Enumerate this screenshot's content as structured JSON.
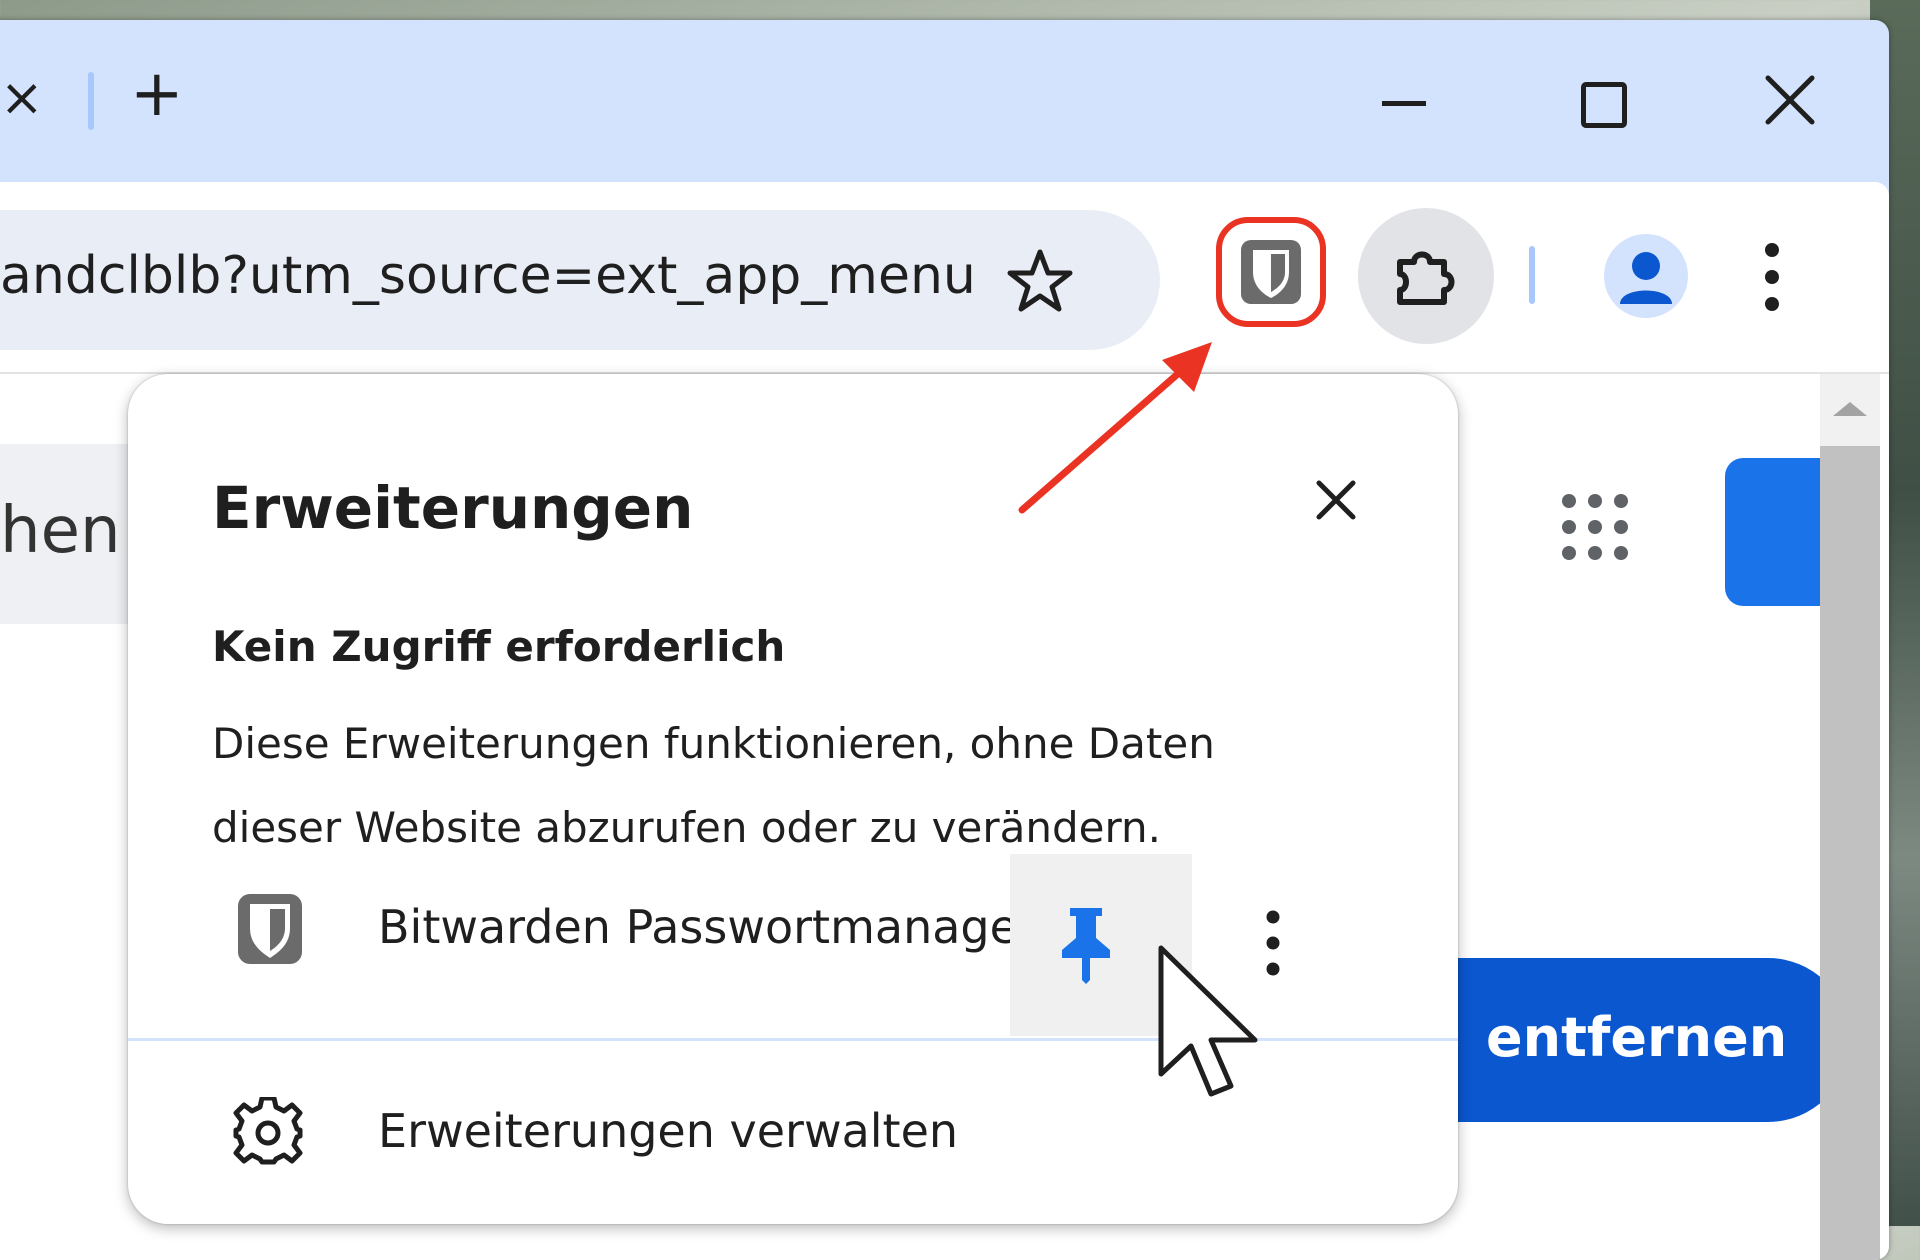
{
  "tabstrip": {
    "tab_close_glyph": "×",
    "new_tab_glyph": "+"
  },
  "omnibox": {
    "url_text": "andclblb?utm_source=ext_app_menu"
  },
  "page": {
    "chip_text": "hen",
    "remove_label": "entfernen"
  },
  "popup": {
    "title": "Erweiterungen",
    "section_heading": "Kein Zugriff erforderlich",
    "section_description": "Diese Erweiterungen funktionieren, ohne Daten dieser Website abzurufen oder zu verändern.",
    "extensions": [
      {
        "name": "Bitwarden Passwortmanager",
        "icon": "bitwarden-shield-icon",
        "pinned": true
      }
    ],
    "manage_label": "Erweiterungen verwalten"
  },
  "colors": {
    "accent_blue": "#0b57d0",
    "pin_blue": "#1a73e8",
    "highlight_red": "#ea3323",
    "tabstrip_bg": "#d3e3fd"
  }
}
